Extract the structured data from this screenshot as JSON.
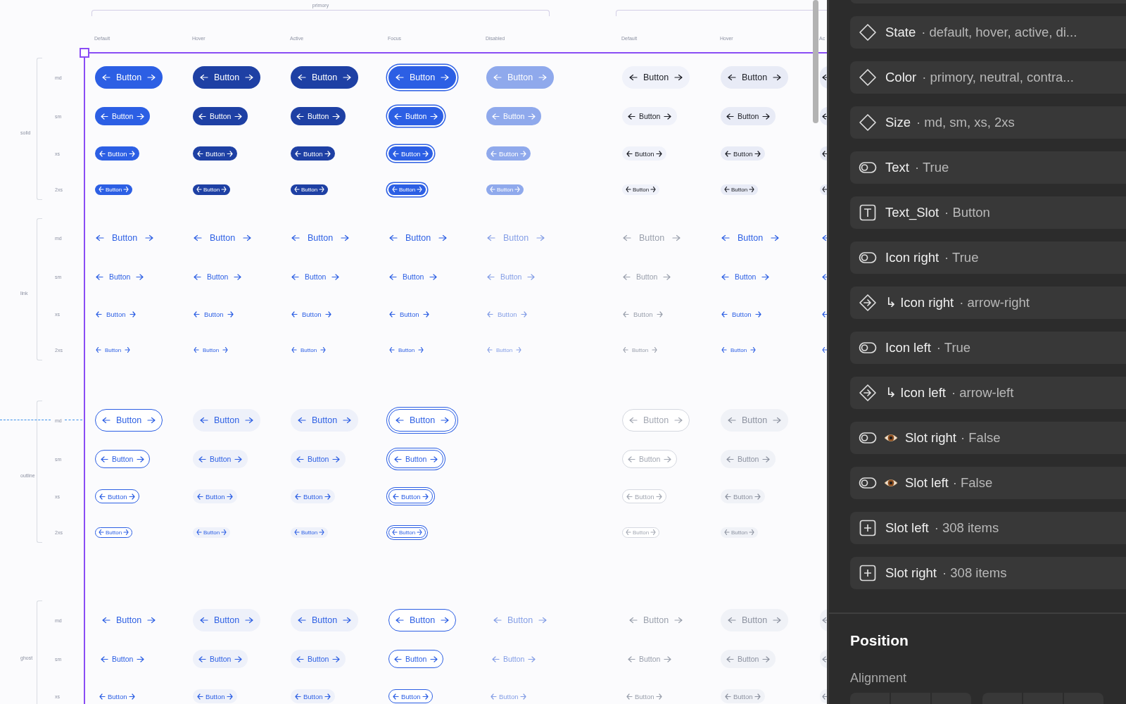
{
  "canvas": {
    "group_label": "primory",
    "columns": [
      {
        "label": "Default"
      },
      {
        "label": "Hover"
      },
      {
        "label": "Active"
      },
      {
        "label": "Focus"
      },
      {
        "label": "Disabled"
      },
      {
        "label": "Default"
      },
      {
        "label": "Hover"
      },
      {
        "label": "Ac"
      }
    ],
    "variants": [
      {
        "label": "solid",
        "sizes": [
          {
            "label": "md",
            "cells": [
              {
                "label": "Button"
              },
              {
                "label": "Button"
              },
              {
                "label": "Button"
              },
              {
                "label": "Button"
              },
              {
                "label": "Button"
              },
              {
                "label": "Button"
              },
              {
                "label": "Button"
              },
              {
                "clipped": true
              }
            ]
          },
          {
            "label": "sm",
            "cells": [
              {
                "label": "Button"
              },
              {
                "label": "Button"
              },
              {
                "label": "Button"
              },
              {
                "label": "Button"
              },
              {
                "label": "Button"
              },
              {
                "label": "Button"
              },
              {
                "label": "Button"
              },
              {
                "clipped": true
              }
            ]
          },
          {
            "label": "xs",
            "cells": [
              {
                "label": "Button"
              },
              {
                "label": "Button"
              },
              {
                "label": "Button"
              },
              {
                "label": "Button"
              },
              {
                "label": "Button"
              },
              {
                "label": "Button"
              },
              {
                "label": "Button"
              },
              {
                "clipped": true
              }
            ]
          },
          {
            "label": "2xs",
            "cells": [
              {
                "label": "Button"
              },
              {
                "label": "Button"
              },
              {
                "label": "Button"
              },
              {
                "label": "Button"
              },
              {
                "label": "Button"
              },
              {
                "label": "Button"
              },
              {
                "label": "Button"
              },
              {
                "clipped": true
              }
            ]
          }
        ]
      },
      {
        "label": "link",
        "sizes": [
          {
            "label": "md",
            "cells": [
              {
                "label": "Button"
              },
              {
                "label": "Button"
              },
              {
                "label": "Button"
              },
              {
                "label": "Button"
              },
              {
                "label": "Button"
              },
              {
                "label": "Button"
              },
              {
                "label": "Button"
              },
              {
                "clipped": true
              }
            ]
          },
          {
            "label": "sm",
            "cells": [
              {
                "label": "Button"
              },
              {
                "label": "Button"
              },
              {
                "label": "Button"
              },
              {
                "label": "Button"
              },
              {
                "label": "Button"
              },
              {
                "label": "Button"
              },
              {
                "label": "Button"
              },
              {
                "clipped": true
              }
            ]
          },
          {
            "label": "xs",
            "cells": [
              {
                "label": "Button"
              },
              {
                "label": "Button"
              },
              {
                "label": "Button"
              },
              {
                "label": "Button"
              },
              {
                "label": "Button"
              },
              {
                "label": "Button"
              },
              {
                "label": "Button"
              },
              {
                "clipped": true
              }
            ]
          },
          {
            "label": "2xs",
            "cells": [
              {
                "label": "Button"
              },
              {
                "label": "Button"
              },
              {
                "label": "Button"
              },
              {
                "label": "Button"
              },
              {
                "label": "Button"
              },
              {
                "label": "Button"
              },
              {
                "label": "Button"
              },
              {
                "clipped": true
              }
            ]
          }
        ]
      },
      {
        "label": "outline",
        "sizes": [
          {
            "label": "md",
            "cells": [
              {
                "label": "Button"
              },
              {
                "label": "Button"
              },
              {
                "label": "Button"
              },
              {
                "label": "Button"
              },
              {
                "empty": true
              },
              {
                "label": "Button"
              },
              {
                "label": "Button"
              },
              {
                "empty": true
              }
            ]
          },
          {
            "label": "sm",
            "cells": [
              {
                "label": "Button"
              },
              {
                "label": "Button"
              },
              {
                "label": "Button"
              },
              {
                "label": "Button"
              },
              {
                "empty": true
              },
              {
                "label": "Button"
              },
              {
                "label": "Button"
              },
              {
                "empty": true
              }
            ]
          },
          {
            "label": "xs",
            "cells": [
              {
                "label": "Button"
              },
              {
                "label": "Button"
              },
              {
                "label": "Button"
              },
              {
                "label": "Button"
              },
              {
                "empty": true
              },
              {
                "label": "Button"
              },
              {
                "label": "Button"
              },
              {
                "empty": true
              }
            ]
          },
          {
            "label": "2xs",
            "cells": [
              {
                "label": "Button"
              },
              {
                "label": "Button"
              },
              {
                "label": "Button"
              },
              {
                "label": "Button"
              },
              {
                "empty": true
              },
              {
                "label": "Button"
              },
              {
                "label": "Button"
              },
              {
                "empty": true
              }
            ]
          }
        ]
      },
      {
        "label": "ghost",
        "sizes": [
          {
            "label": "md",
            "cells": [
              {
                "label": "Button"
              },
              {
                "label": "Button"
              },
              {
                "label": "Button"
              },
              {
                "label": "Button"
              },
              {
                "label": "Button"
              },
              {
                "label": "Button"
              },
              {
                "label": "Button"
              },
              {
                "clipped": true
              }
            ]
          },
          {
            "label": "sm",
            "cells": [
              {
                "label": "Button"
              },
              {
                "label": "Button"
              },
              {
                "label": "Button"
              },
              {
                "label": "Button"
              },
              {
                "label": "Button"
              },
              {
                "label": "Button"
              },
              {
                "label": "Button"
              },
              {
                "clipped": true
              }
            ]
          },
          {
            "label": "xs",
            "cells": [
              {
                "label": "Button"
              },
              {
                "label": "Button"
              },
              {
                "label": "Button"
              },
              {
                "label": "Button"
              },
              {
                "label": "Button"
              },
              {
                "label": "Button"
              },
              {
                "label": "Button"
              },
              {
                "clipped": true
              }
            ]
          }
        ]
      }
    ]
  },
  "panel": {
    "properties": [
      {
        "kind": "variant",
        "name": "State",
        "value": "· default, hover, active, di..."
      },
      {
        "kind": "variant",
        "name": "Color",
        "value": "· primory, neutral, contra..."
      },
      {
        "kind": "variant",
        "name": "Size",
        "value": "· md, sm, xs, 2xs"
      },
      {
        "kind": "boolean",
        "name": "Text",
        "value": "· True"
      },
      {
        "kind": "text",
        "name": "Text_Slot",
        "value": "· Button"
      },
      {
        "kind": "boolean",
        "name": "Icon right",
        "value": "· True"
      },
      {
        "kind": "swap",
        "name": "↳ Icon right",
        "value": "· arrow-right"
      },
      {
        "kind": "boolean",
        "name": "Icon left",
        "value": "· True"
      },
      {
        "kind": "swap",
        "name": "↳ Icon left",
        "value": "· arrow-left"
      },
      {
        "kind": "boolean",
        "eye": true,
        "name": "Slot right",
        "value": "· False"
      },
      {
        "kind": "boolean",
        "eye": true,
        "name": "Slot left",
        "value": "· False"
      },
      {
        "kind": "slot",
        "name": "Slot left",
        "value": "· 308 items"
      },
      {
        "kind": "slot",
        "name": "Slot right",
        "value": "· 308 items"
      }
    ],
    "section_title": "Position",
    "subsection_title": "Alignment"
  }
}
